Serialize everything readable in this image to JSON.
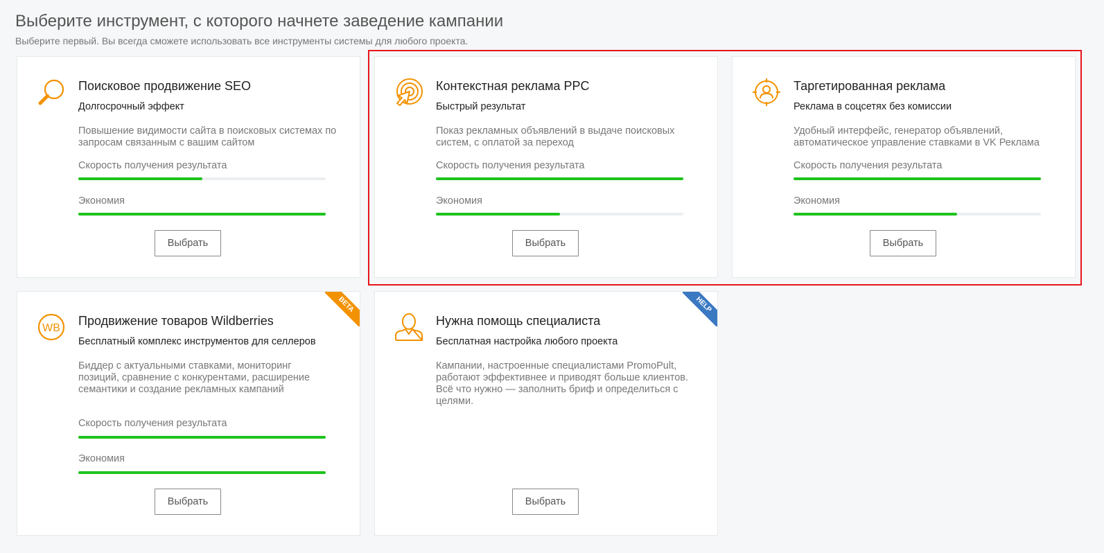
{
  "header": {
    "title": "Выберите инструмент, с которого начнете заведение кампании",
    "subtitle": "Выберите первый. Вы всегда сможете использовать все инструменты системы для любого проекта."
  },
  "colors": {
    "accent": "#f39200",
    "progress": "#1ec31e",
    "track": "#eceff1",
    "highlight": "#e8141b",
    "beta": "#f39200",
    "help": "#3b78c2"
  },
  "metric_labels": {
    "speed": "Скорость получения результата",
    "economy": "Экономия"
  },
  "button_label": "Выбрать",
  "cards": [
    {
      "icon": "magnifier-icon",
      "title": "Поисковое продвижение SEO",
      "subtitle": "Долгосрочный эффект",
      "description": "Повышение видимости сайта в поисковых системах по запросам связанным с вашим сайтом",
      "speed": 0.5,
      "economy": 1.0
    },
    {
      "icon": "target-click-icon",
      "title": "Контекстная реклама PPC",
      "subtitle": "Быстрый результат",
      "description": "Показ рекламных объявлений в выдаче поисковых систем, с оплатой за переход",
      "speed": 1.0,
      "economy": 0.5
    },
    {
      "icon": "target-person-icon",
      "title": "Таргетированная реклама",
      "subtitle": "Реклама в соцсетях без комиссии",
      "description": "Удобный интерфейс, генератор объявлений, автоматическое управление ставками в VK Реклама",
      "speed": 1.0,
      "economy": 0.66
    },
    {
      "icon": "wb-icon",
      "title": "Продвижение товаров Wildberries",
      "subtitle": "Бесплатный комплекс инструментов для селлеров",
      "description": "Биддер с актуальными ставками, мониторинг позиций, сравнение с конкурентами, расширение семантики и создание рекламных кампаний",
      "speed": 1.0,
      "economy": 1.0,
      "badge": "BETA"
    },
    {
      "icon": "person-icon",
      "title": "Нужна помощь специалиста",
      "subtitle": "Бесплатная настройка любого проекта",
      "description": "Кампании, настроенные специалистами PromoPult, работают эффективнее и приводят больше клиентов. Всё что нужно — заполнить бриф и определиться с целями.",
      "badge": "HELP"
    }
  ]
}
